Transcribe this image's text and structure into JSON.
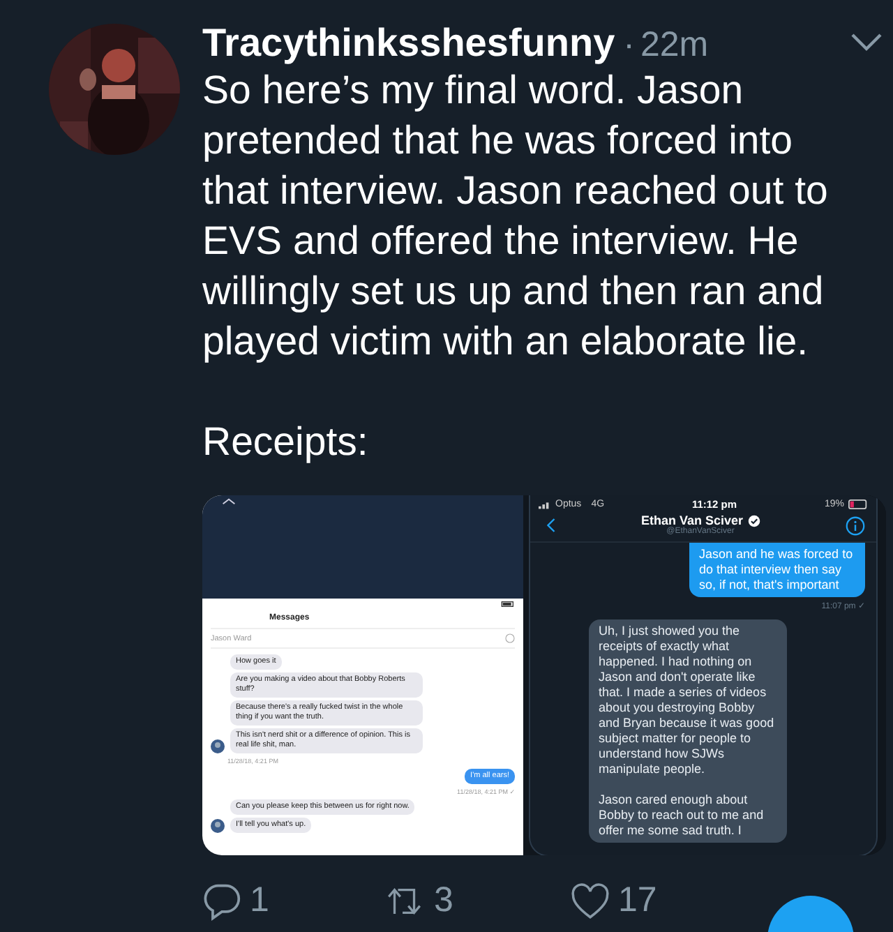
{
  "tweet": {
    "author": "Tracythinksshesfunny",
    "separator": "·",
    "time": "22m",
    "text": "So here’s my final word. Jason pretended that he was forced into that interview. Jason reached out to EVS and offered the interview. He willingly set us up and then ran and played victim with an elaborate lie.",
    "text_2": "Receipts:"
  },
  "left_screenshot": {
    "title": "Messages",
    "contact": "Jason Ward",
    "messages": [
      {
        "kind": "in",
        "text": "How goes it",
        "avatar": false
      },
      {
        "kind": "in",
        "text": "Are you making a video about that Bobby Roberts stuff?",
        "avatar": false
      },
      {
        "kind": "in",
        "text": "Because there's a really fucked twist in the whole thing if you want the truth.",
        "avatar": false
      },
      {
        "kind": "in",
        "text": "This isn't nerd shit or a difference of opinion. This is real life shit, man.",
        "avatar": true
      },
      {
        "kind": "time_in",
        "text": "11/28/18, 4:21 PM"
      },
      {
        "kind": "out",
        "text": "I'm all ears!"
      },
      {
        "kind": "time_out",
        "text": "11/28/18, 4:21 PM ✓"
      },
      {
        "kind": "in",
        "text": "Can you please keep this between us for right now.",
        "avatar": false
      },
      {
        "kind": "in",
        "text": "I'll tell you what's up.",
        "avatar": true
      }
    ]
  },
  "right_screenshot": {
    "carrier": "Optus",
    "network": "4G",
    "clock": "11:12 pm",
    "battery": "19%",
    "name": "Ethan Van Sciver",
    "handle": "@EthanVanSciver",
    "messages": [
      {
        "kind": "out",
        "text": "Jason and he was forced to do that interview then say so, if not, that's important"
      },
      {
        "kind": "time_out",
        "text": "11:07 pm ✓"
      },
      {
        "kind": "in",
        "text": "Uh, I just showed you the receipts of exactly what happened.  I had nothing on Jason and don't operate like that.  I made a series of videos about you destroying Bobby and Bryan because it was good subject matter for people to understand how SJWs manipulate people.\n\nJason cared enough about Bobby to reach out to me and offer me some sad truth.  I"
      }
    ]
  },
  "actions": [
    {
      "kind": "reply",
      "count": "1"
    },
    {
      "kind": "retweet",
      "count": "3"
    },
    {
      "kind": "like",
      "count": "17"
    }
  ]
}
